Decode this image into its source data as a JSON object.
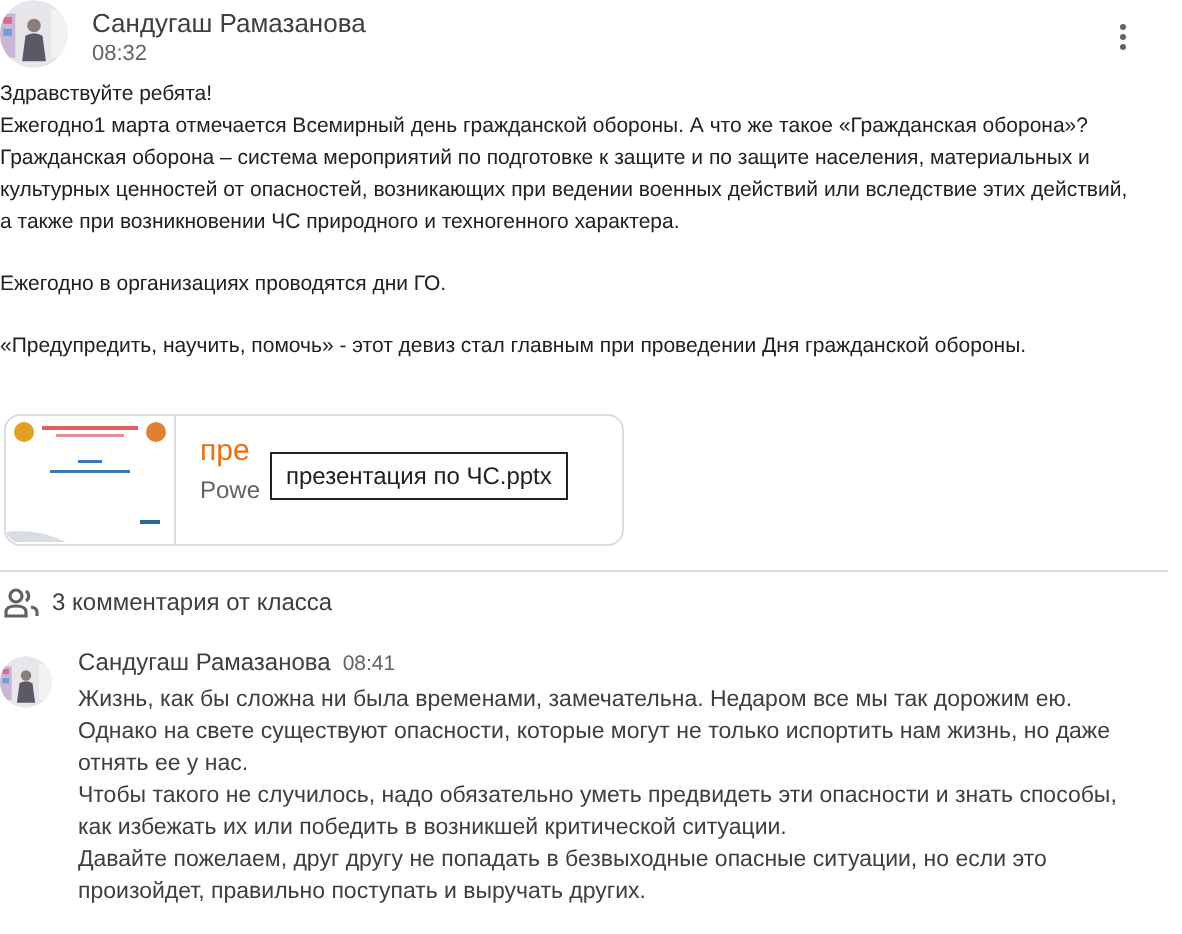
{
  "post": {
    "author": "Сандугаш Рамазанова",
    "time": "08:32",
    "paragraphs": [
      [
        "Здравствуйте ребята!",
        "Ежегодно1 марта отмечается Всемирный день гражданской обороны. А что же такое «Гражданская оборона»?",
        "Гражданская оборона – система мероприятий по подготовке к защите и по защите населения, материальных и",
        "культурных ценностей от опасностей, возникающих при ведении военных действий или вследствие этих действий,",
        "а также при возникновении ЧС природного и техногенного характера."
      ],
      [
        "Ежегодно в организациях проводятся дни ГО."
      ],
      [
        "«Предупредить, научить, помочь» - этот девиз стал главным при проведении Дня гражданской обороны."
      ]
    ],
    "attachment": {
      "title": "пре",
      "subtitle": "Powe",
      "tooltip": "презентация по ЧС.pptx"
    }
  },
  "comments_header": "3 комментария от класса",
  "comments": [
    {
      "author": "Сандугаш Рамазанова",
      "time": "08:41",
      "lines": [
        "Жизнь, как бы сложна ни была временами, замечательна. Недаром все мы так дорожим ею.",
        "Однако на свете существуют опасности, которые могут не только испортить нам жизнь, но даже",
        "отнять ее у нас.",
        "Чтобы такого не случилось, надо обязательно уметь предвидеть эти опасности и знать способы,",
        "как избежать их или победить в возникшей критической ситуации.",
        "Давайте пожелаем, друг другу не попадать в безвыходные опасные ситуации, но если это",
        "произойдет, правильно поступать и выручать других."
      ]
    }
  ]
}
